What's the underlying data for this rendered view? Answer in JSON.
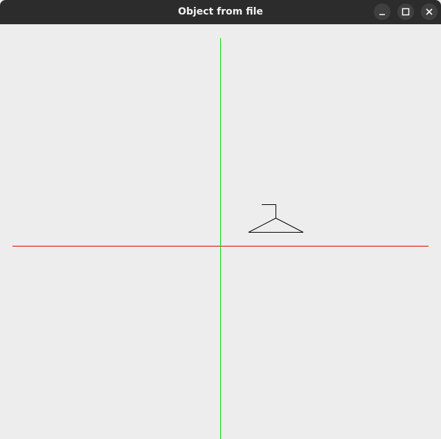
{
  "window": {
    "title": "Object from file",
    "controls": {
      "minimize": "minimize-icon",
      "maximize": "maximize-icon",
      "close": "close-icon"
    }
  },
  "canvas": {
    "background": "#ededed",
    "x_axis_color": "#e00000",
    "y_axis_color": "#00dd00",
    "object_color": "#000000"
  }
}
